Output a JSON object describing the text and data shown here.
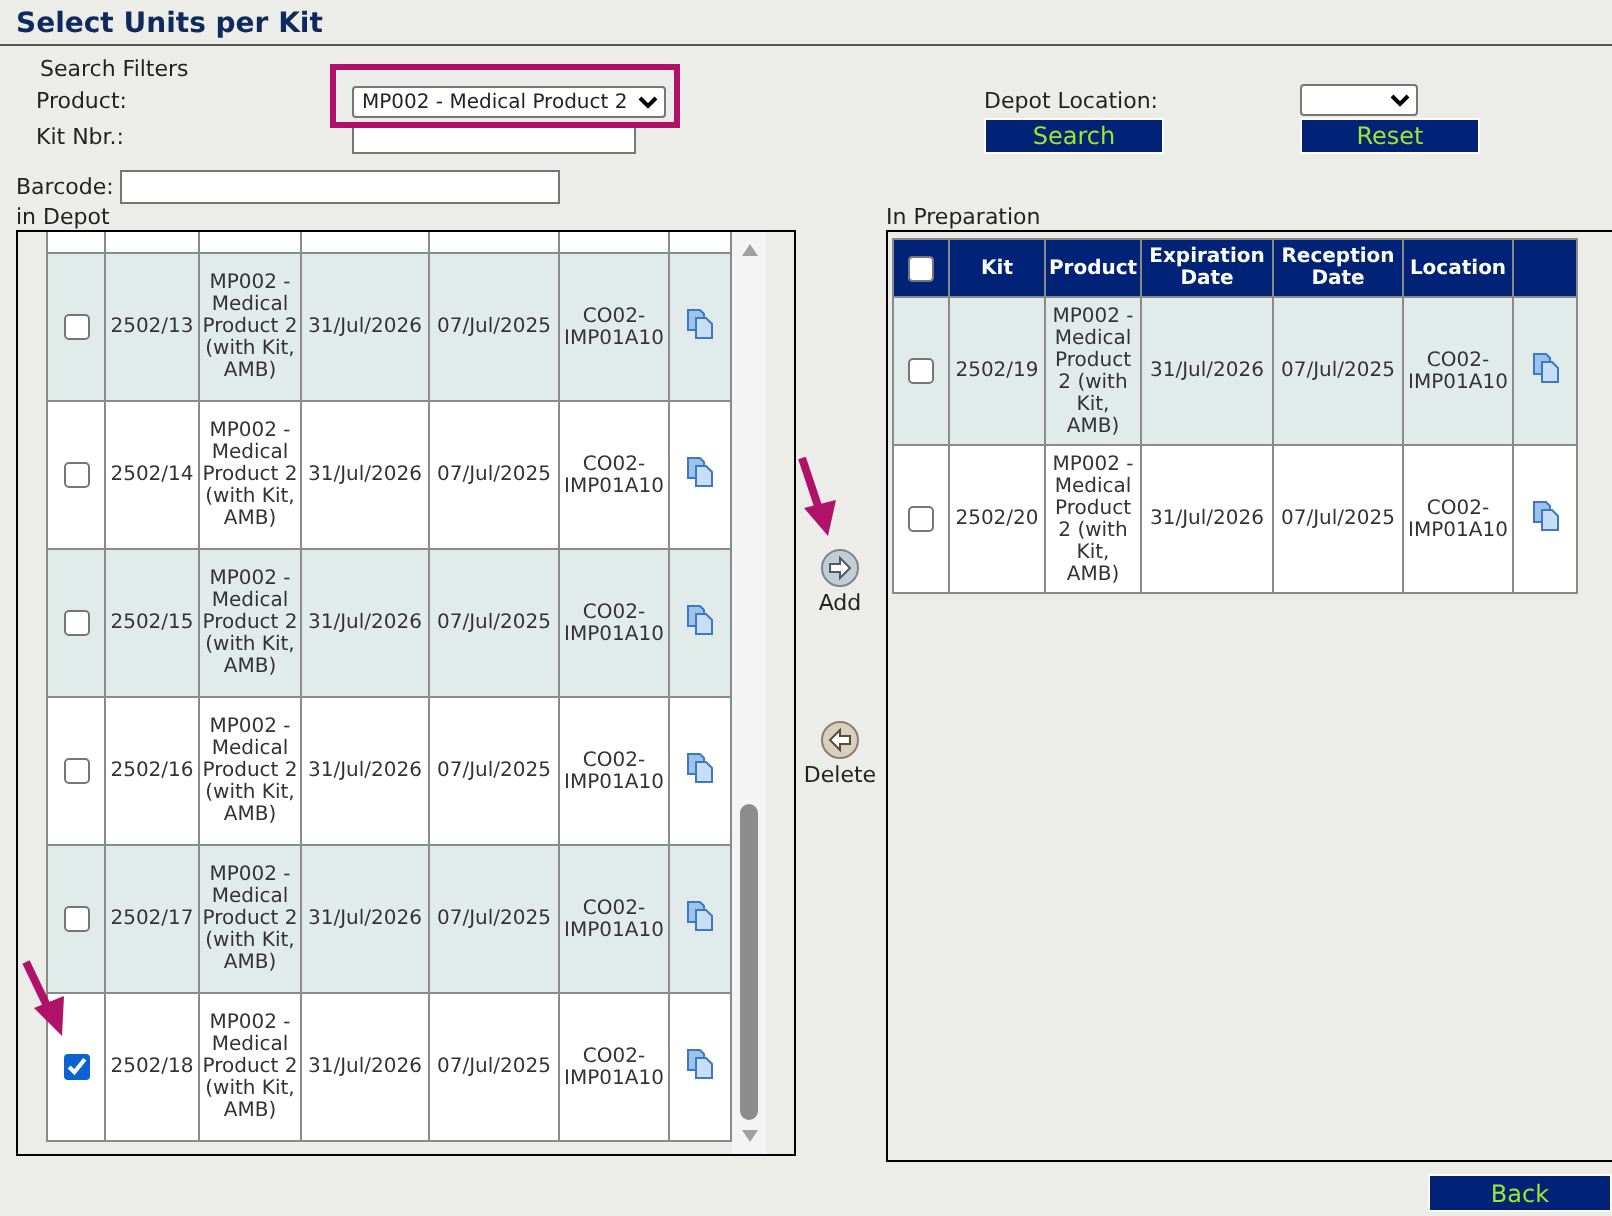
{
  "title": "Select Units per Kit",
  "filters": {
    "heading": "Search Filters",
    "product_label": "Product:",
    "product_value": "MP002 - Medical Product 2",
    "kit_label": "Kit Nbr.:",
    "depot_label": "Depot Location:",
    "barcode_label": "Barcode:"
  },
  "search_button": "Search",
  "reset_button": "Reset",
  "in_depot": {
    "title": "in Depot",
    "rows": [
      {
        "kit": "2502/13",
        "product": "MP002 - Medical Product 2 (with Kit, AMB)",
        "expiration": "31/Jul/2026",
        "reception": "07/Jul/2025",
        "location": "CO02-IMP01A10",
        "checked": false
      },
      {
        "kit": "2502/14",
        "product": "MP002 - Medical Product 2 (with Kit, AMB)",
        "expiration": "31/Jul/2026",
        "reception": "07/Jul/2025",
        "location": "CO02-IMP01A10",
        "checked": false
      },
      {
        "kit": "2502/15",
        "product": "MP002 - Medical Product 2 (with Kit, AMB)",
        "expiration": "31/Jul/2026",
        "reception": "07/Jul/2025",
        "location": "CO02-IMP01A10",
        "checked": false
      },
      {
        "kit": "2502/16",
        "product": "MP002 - Medical Product 2 (with Kit, AMB)",
        "expiration": "31/Jul/2026",
        "reception": "07/Jul/2025",
        "location": "CO02-IMP01A10",
        "checked": false
      },
      {
        "kit": "2502/17",
        "product": "MP002 - Medical Product 2 (with Kit, AMB)",
        "expiration": "31/Jul/2026",
        "reception": "07/Jul/2025",
        "location": "CO02-IMP01A10",
        "checked": false
      },
      {
        "kit": "2502/18",
        "product": "MP002 - Medical Product 2 (with Kit, AMB)",
        "expiration": "31/Jul/2026",
        "reception": "07/Jul/2025",
        "location": "CO02-IMP01A10",
        "checked": true
      }
    ]
  },
  "add_button": "Add",
  "delete_button": "Delete",
  "in_preparation": {
    "title": "In Preparation",
    "header_checked": false,
    "columns": [
      "Kit",
      "Product",
      "Expiration Date",
      "Reception Date",
      "Location"
    ],
    "rows": [
      {
        "kit": "2502/19",
        "product": "MP002 - Medical Product 2 (with Kit, AMB)",
        "expiration": "31/Jul/2026",
        "reception": "07/Jul/2025",
        "location": "CO02-IMP01A10",
        "checked": false
      },
      {
        "kit": "2502/20",
        "product": "MP002 - Medical Product 2 (with Kit, AMB)",
        "expiration": "31/Jul/2026",
        "reception": "07/Jul/2025",
        "location": "CO02-IMP01A10",
        "checked": false
      }
    ]
  },
  "back_button": "Back"
}
